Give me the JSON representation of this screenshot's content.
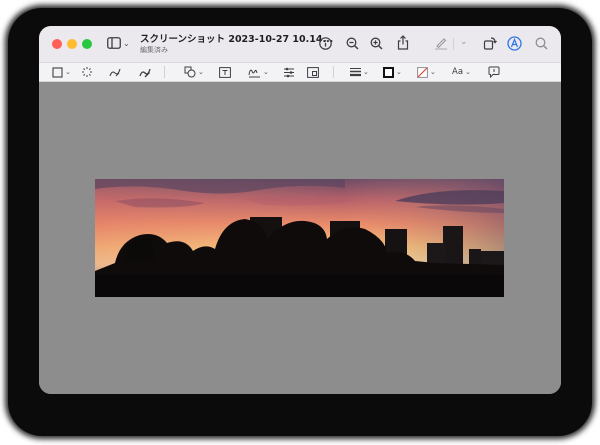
{
  "window": {
    "title": "スクリーンショット 2023-10-27 10.14...",
    "subtitle": "編集済み"
  },
  "icons": {
    "sidebar": "sidebar-toggle-icon",
    "info": "info-icon",
    "zoom_out": "zoom-out-icon",
    "zoom_in": "zoom-in-icon",
    "share": "share-icon",
    "highlight": "highlight-pen-icon",
    "rotate": "rotate-icon",
    "markup": "markup-icon",
    "search": "search-icon"
  },
  "toolbar": {
    "font_label": "Aa"
  },
  "colors": {
    "accent": "#2f74e6",
    "window_bg": "#8d8d8d",
    "titlebar_bg": "#ebe9ee",
    "toolbar_bg": "#f3f2f5"
  }
}
